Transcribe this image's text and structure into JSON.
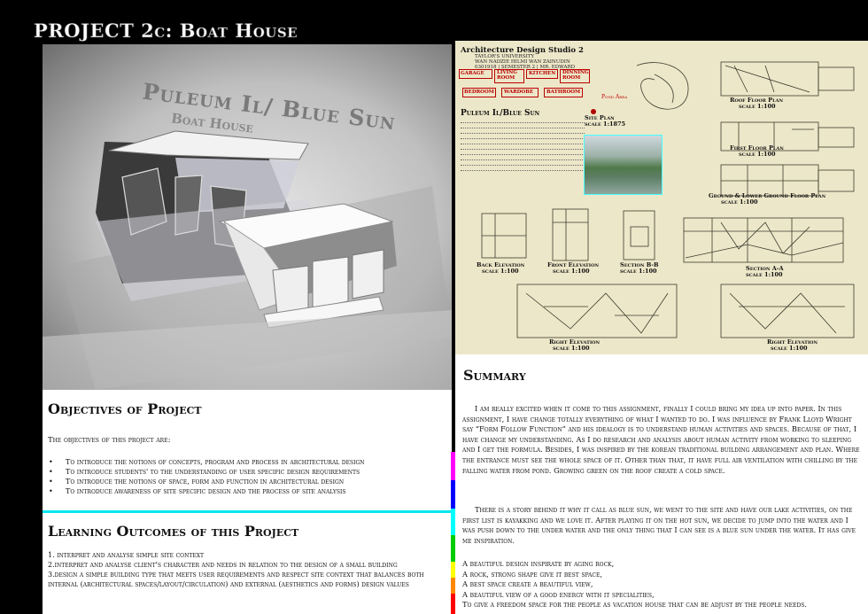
{
  "page": {
    "title": "PROJECT 2c: Boat House"
  },
  "photo": {
    "caption_line1": "Puleum Il/ Blue Sun",
    "caption_line2": "Boat House"
  },
  "objectives": {
    "heading": "Objectives of Project",
    "intro": "The objectives of this project are:",
    "items": [
      "To introduce the notions of concepts, program and process in architectural design",
      "To introduce students' to the understanding of user specific design requirements",
      "To introduce the notions of space, form and function in architectural design",
      "To introduce awareness of site specific design and the process of site analysis"
    ]
  },
  "learning_outcomes": {
    "heading": "Learning Outcomes of this Project",
    "items": [
      "1. interpret and analyse simple site context",
      "2.interpret and analyse client's character and needs in relation to the design of a small building",
      "3.design a simple building type that meets user requirements and respect site context that balances both internal (architectural spaces/layout/circulation) and external (aesthetics and forms) design values"
    ]
  },
  "sheet": {
    "header": "Architecture Design Studio 2",
    "university": "TAYLOR'S UNIVERSITY",
    "student_lines": [
      "WAN NADZIE HILMI WAN ZAINUDIN",
      "0301918 | SEMESTER 2 | MR. EDWARD"
    ],
    "flow": [
      "GARAGE",
      "LIVING ROOM",
      "KITCHEN",
      "DINNING ROOM",
      "BEDROOM",
      "WARDOBE",
      "BATHROOM"
    ],
    "pond_label": "Pond Area",
    "site_title": "Puleum Il/Blue Sun",
    "site_plan": "Site Plan",
    "site_plan_scale": "scale 1:1875",
    "drawings": [
      {
        "name": "Roof Floor Plan",
        "scale": "scale 1:100"
      },
      {
        "name": "First Floor Plan",
        "scale": "scale 1:100"
      },
      {
        "name": "Ground & Lower Ground Floor Plan",
        "scale": "scale 1:100"
      },
      {
        "name": "Back Elevation",
        "scale": "scale 1:100"
      },
      {
        "name": "Front Elevation",
        "scale": "scale 1:100"
      },
      {
        "name": "Section B-B",
        "scale": "scale 1:100"
      },
      {
        "name": "Section A-A",
        "scale": "scale 1:100"
      },
      {
        "name": "Right Elevation",
        "scale": "scale 1:100"
      },
      {
        "name": "Right Elevation",
        "scale": "scale 1:100"
      }
    ]
  },
  "summary": {
    "heading": "Summary",
    "paragraph1": "I am really excited when it come to this assignment, finally I could bring my idea up into paper. In this assignment, I have change totally everything of what I wanted to do. I was influence by Frank Lloyd Wright say “Form Follow Function” and his idealogy is to understand human activities and spaces. Because of that, I have change my understanding. As I do research and analysis about human activity from working to sleeping and I get the formula. Besides, I was inspired by the korean traditional building arrangement and plan. Where the entrance must see the whole space of it. Other than that, it have full air ventilation with chilling by the falling water from pond. Growing green on the roof create a cold space.",
    "paragraph2": "There is a story behind it why it call as blue sun, we went to the site and have our lake activities, on the first list is kayakking and we love it. After playing it on the hot sun, we decide to jump into the water and I was push down to the under water and the only thing that I can see is a blue sun under the water. It has give me inspiration.",
    "inspirations": [
      "A beautiful design inspirate by aging rock,",
      "A rock, strong shape give it best space,",
      "A best space create a beautiful view,",
      "A beautiful view of a good energy with it specialities,",
      "To give a freedom space for the people as vacation house that can be adjust by the people needs."
    ]
  },
  "colors": {
    "background": "#000000",
    "accent_cyan": "#00e5ee",
    "sheet_paper": "#ede7c9",
    "flow_red": "#bb0000",
    "bar_colors": [
      "#ff00ff",
      "#0000ff",
      "#00ffff",
      "#00cc00",
      "#ffff00",
      "#ff8800",
      "#ff0000"
    ]
  }
}
